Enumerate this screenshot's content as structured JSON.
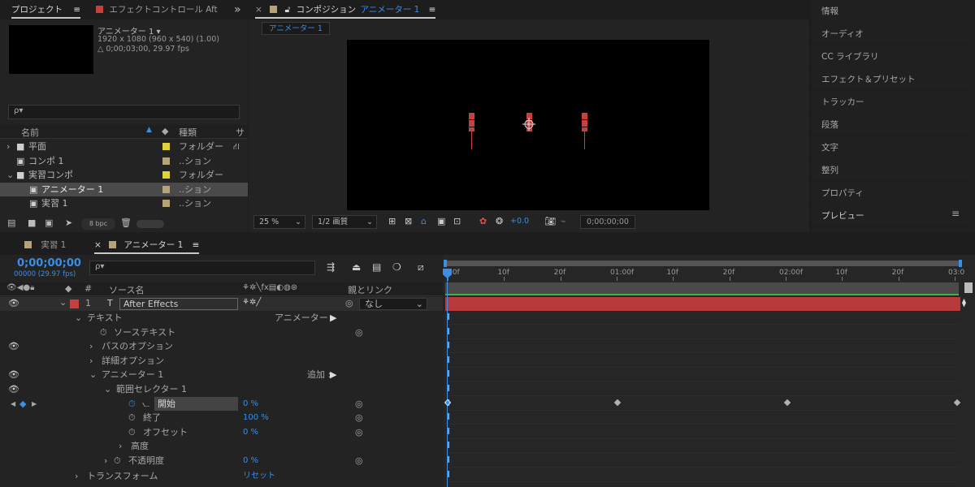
{
  "project": {
    "tab_label": "プロジェクト",
    "menu_glyph": "≡",
    "effect_tab": "エフェクトコントロール After Effe",
    "more_glyph": "»",
    "comp_name": "アニメーター 1 ▾",
    "resolution": "1920 x 1080  (960 x 540) (1.00)",
    "duration": "△ 0;00;03;00, 29.97 fps",
    "search_glyph": "ρ▾",
    "col_name": "名前",
    "col_type": "種類",
    "col_s": "サ",
    "items": [
      {
        "name": "平面",
        "type": "フォルダー",
        "color": "#e0d23c",
        "indent": 0,
        "kind": "folder",
        "twirl": "›"
      },
      {
        "name": "コンポ 1",
        "type": "..ション",
        "color": "#b7a37a",
        "indent": 0,
        "kind": "comp",
        "twirl": ""
      },
      {
        "name": "実習コンポ",
        "type": "フォルダー",
        "color": "#e0d23c",
        "indent": 0,
        "kind": "folder",
        "twirl": "⌄"
      },
      {
        "name": "アニメーター 1",
        "type": "..ション",
        "color": "#b7a37a",
        "indent": 1,
        "kind": "comp",
        "twirl": ""
      },
      {
        "name": "実習 1",
        "type": "..ション",
        "color": "#b7a37a",
        "indent": 1,
        "kind": "comp",
        "twirl": ""
      }
    ],
    "bpc": "8 bpc"
  },
  "composition": {
    "tab_close": "×",
    "tab_label": "コンポジション",
    "tab_comp_name": "アニメーター 1",
    "menu_glyph": "≡",
    "breadcrumb": "アニメーター 1",
    "zoom": "25 %",
    "quality": "1/2 画質",
    "exposure": "+0.0",
    "timecode": "0;00;00;00"
  },
  "right_panel": {
    "items": [
      "情報",
      "オーディオ",
      "CC ライブラリ",
      "エフェクト＆プリセット",
      "トラッカー",
      "段落",
      "文字",
      "整列",
      "プロパティ",
      "プレビュー"
    ],
    "menu_glyph": "≡"
  },
  "timeline": {
    "tabs": [
      {
        "label": "実習 1",
        "active": false
      },
      {
        "label": "アニメーター 1",
        "active": true
      }
    ],
    "close_glyph": "×",
    "menu_glyph": "≡",
    "timecode": "0;00;00;00",
    "frame_info": "00000 (29.97 fps)",
    "search_glyph": "ρ▾",
    "col_hash": "#",
    "col_source": "ソース名",
    "col_parent": "親とリンク",
    "layer": {
      "number": "1",
      "type_glyph": "T",
      "name": "After Effects",
      "parent": "なし"
    },
    "props": {
      "text": "テキスト",
      "animator_label": "アニメーター :",
      "source_text": "ソーステキスト",
      "path_options": "パスのオプション",
      "more_options": "詳細オプション",
      "animator1": "アニメーター 1",
      "add_label": "追加 :",
      "range_selector": "範囲セレクター 1",
      "start": "開始",
      "start_value": "0 %",
      "end": "終了",
      "end_value": "100 %",
      "offset": "オフセット",
      "offset_value": "0 %",
      "advanced": "高度",
      "opacity": "不透明度",
      "opacity_value": "0 %",
      "transform": "トランスフォーム",
      "reset": "リセット"
    },
    "ruler_ticks": [
      "00f",
      "10f",
      "20f",
      "01:00f",
      "10f",
      "20f",
      "02:00f",
      "10f",
      "20f",
      "03:0"
    ],
    "ibeam": "I"
  },
  "colors": {
    "accent_blue": "#3a8ee6",
    "layer_red": "#b83a3a",
    "label_red": "#c8403e"
  }
}
